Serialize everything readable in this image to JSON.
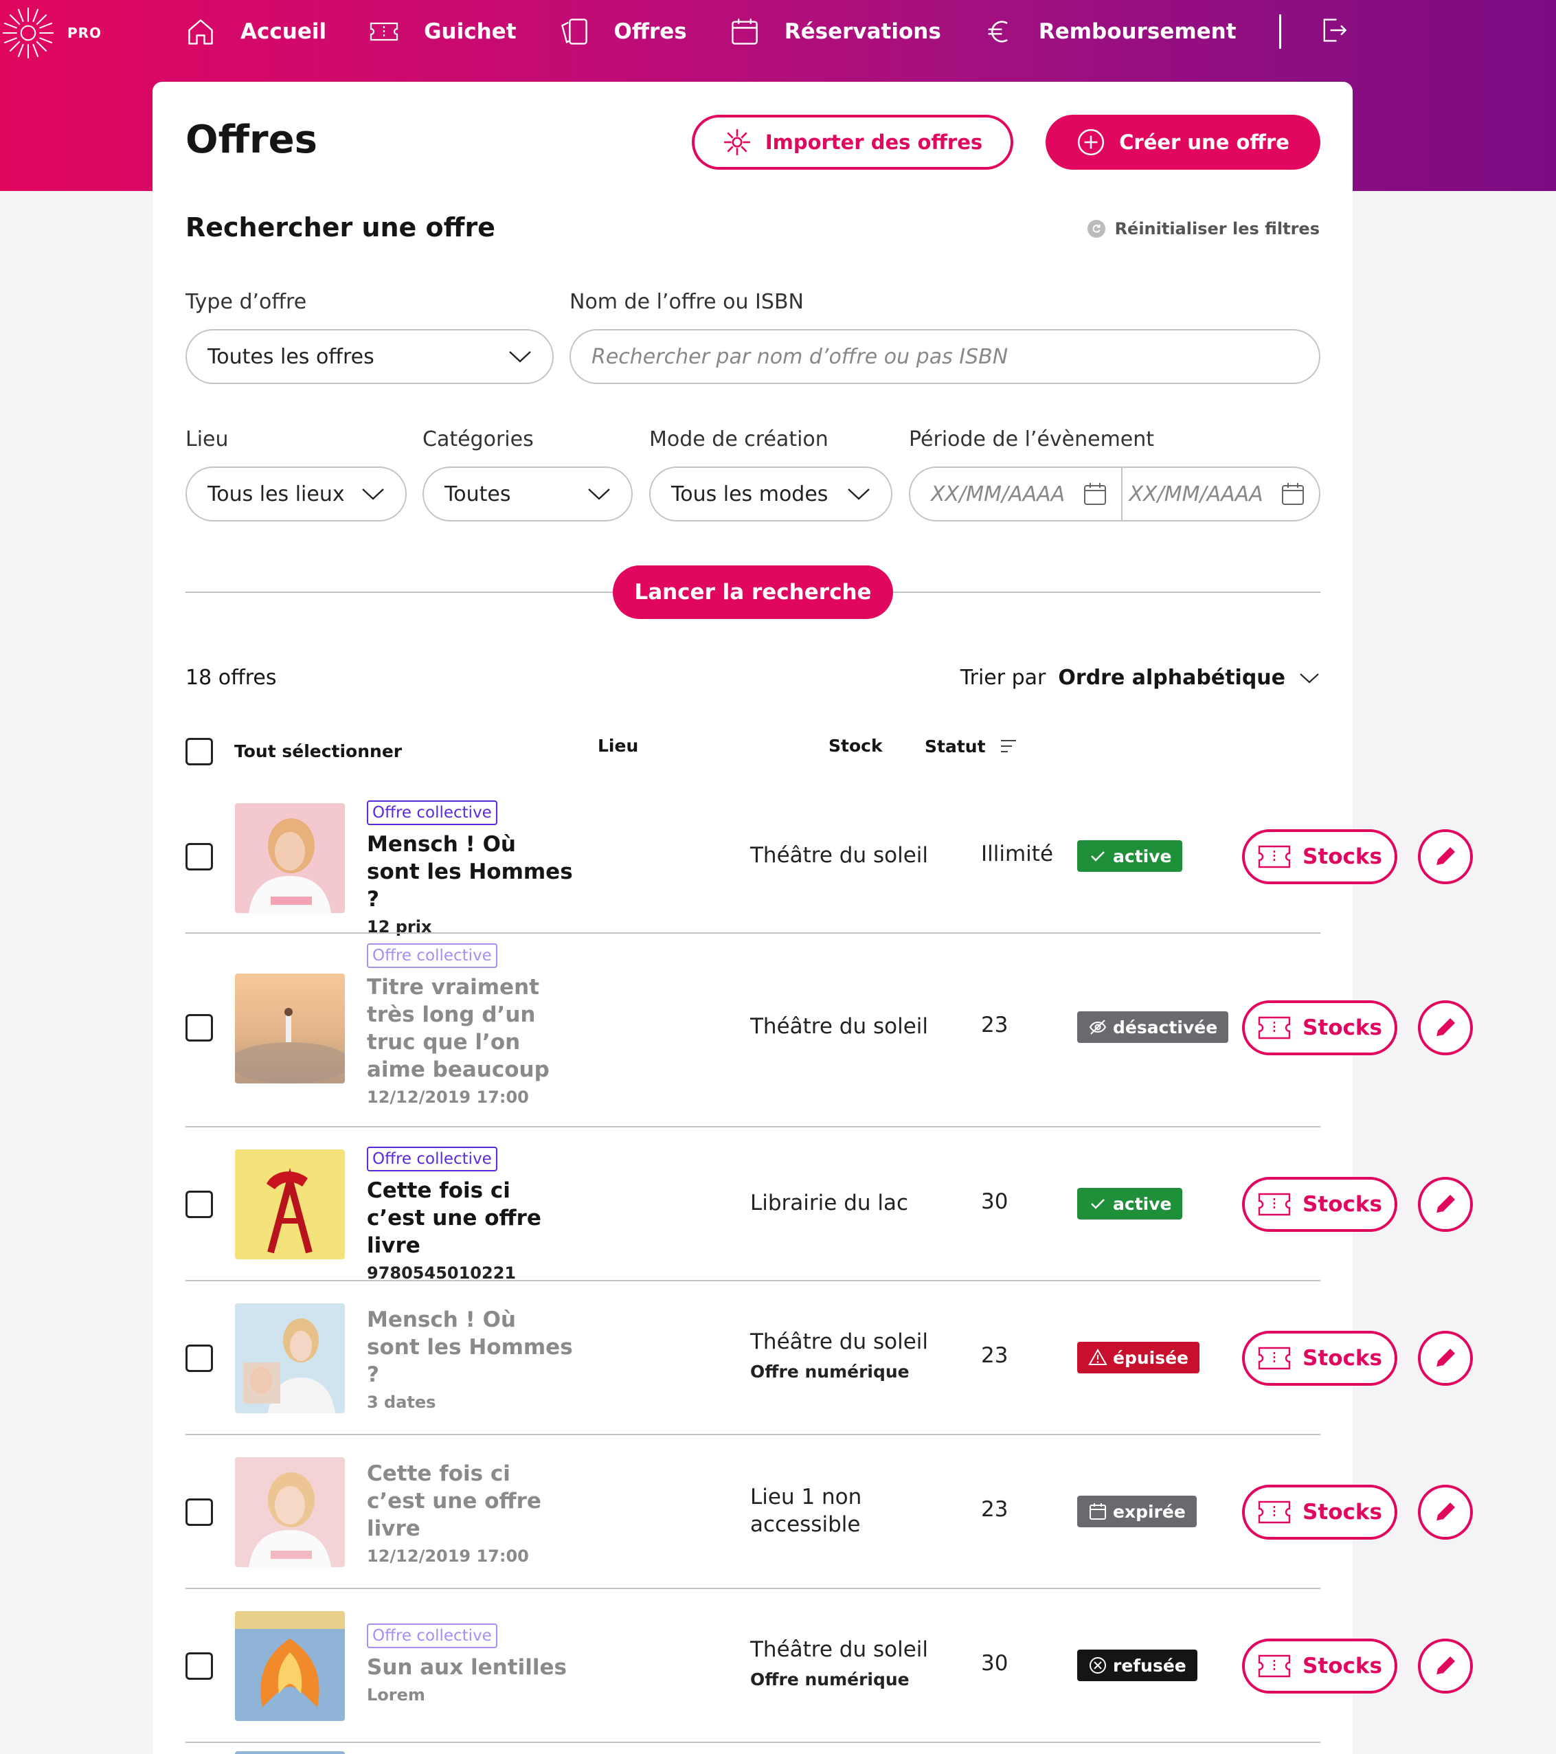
{
  "header": {
    "logo_text": "PRO",
    "nav": [
      {
        "label": "Accueil",
        "icon": "home-icon"
      },
      {
        "label": "Guichet",
        "icon": "ticket-icon"
      },
      {
        "label": "Offres",
        "icon": "offers-icon"
      },
      {
        "label": "Réservations",
        "icon": "calendar-icon"
      },
      {
        "label": "Remboursement",
        "icon": "euro-icon"
      }
    ],
    "logout_icon": "logout-icon"
  },
  "page": {
    "title": "Offres",
    "import_button": "Importer des offres",
    "create_button": "Créer une offre"
  },
  "search": {
    "title": "Rechercher une offre",
    "reset": "Réinitialiser les filtres",
    "type_label": "Type d’offre",
    "type_value": "Toutes les offres",
    "name_label": "Nom de l’offre ou ISBN",
    "name_placeholder": "Rechercher par nom d’offre ou pas ISBN",
    "lieu_label": "Lieu",
    "lieu_value": "Tous les lieux",
    "categories_label": "Catégories",
    "categories_value": "Toutes",
    "mode_label": "Mode de création",
    "mode_value": "Tous les modes",
    "period_label": "Période de l’évènement",
    "date_placeholder_start": "XX/MM/AAAA",
    "date_placeholder_end": "XX/MM/AAAA",
    "submit": "Lancer la recherche"
  },
  "results": {
    "count": "18 offres",
    "sort_prefix": "Trier par",
    "sort_value": "Ordre alphabétique",
    "columns": {
      "select_all": "Tout sélectionner",
      "lieu": "Lieu",
      "stock": "Stock",
      "statut": "Statut"
    },
    "stocks_label": "Stocks"
  },
  "rows": [
    {
      "tag": "Offre collective",
      "title": "Mensch ! Où sont les Hommes ?",
      "sub": "12 prix",
      "lieu": "Théâtre du soleil",
      "lieu_sub": "",
      "stock": "Illimité",
      "status": "active",
      "status_color": "#1f8f3a"
    },
    {
      "tag": "Offre collective",
      "title": "Titre vraiment très long d’un truc que l’on aime beaucoup",
      "sub": "12/12/2019 17:00",
      "lieu": "Théâtre du soleil",
      "lieu_sub": "",
      "stock": "23",
      "status": "désactivée",
      "status_color": "#696a6f"
    },
    {
      "tag": "Offre collective",
      "title": "Cette fois ci c’est une offre livre",
      "sub": "9780545010221",
      "lieu": "Librairie du lac",
      "lieu_sub": "",
      "stock": "30",
      "status": "active",
      "status_color": "#1f8f3a"
    },
    {
      "tag": "",
      "title": "Mensch ! Où sont les Hommes ?",
      "sub": "3 dates",
      "lieu": "Théâtre du soleil",
      "lieu_sub": "Offre numérique",
      "stock": "23",
      "status": "épuisée",
      "status_color": "#c8102e"
    },
    {
      "tag": "",
      "title": "Cette fois ci c’est une offre livre",
      "sub": "12/12/2019 17:00",
      "lieu": "Lieu 1 non accessible",
      "lieu_sub": "",
      "stock": "23",
      "status": "expirée",
      "status_color": "#696a6f"
    },
    {
      "tag": "Offre collective",
      "title": "Sun aux lentilles",
      "sub": "Lorem",
      "lieu": "Théâtre du soleil",
      "lieu_sub": "Offre numérique",
      "stock": "30",
      "status": "refusée",
      "status_color": "#151515"
    }
  ],
  "colors": {
    "brand": "#e1075f",
    "collective_tag": "#5b2adb"
  }
}
